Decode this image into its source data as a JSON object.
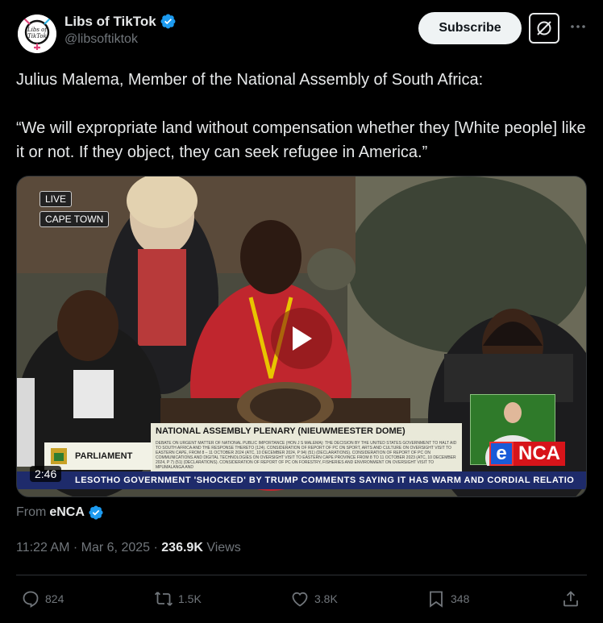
{
  "author": {
    "display_name": "Libs of TikTok",
    "handle": "@libsoftiktok",
    "avatar_text_line1": "Libs of",
    "avatar_text_line2": "TikTok",
    "verified": true
  },
  "header_actions": {
    "subscribe_label": "Subscribe",
    "grok_icon": "grok-icon",
    "more_icon": "more-icon"
  },
  "tweet": {
    "line1": "Julius Malema, Member of the National Assembly of South Africa:",
    "line2": "“We will expropriate land without compensation whether they [White people] like it or not. If they object, they can seek refugee in America.”"
  },
  "video": {
    "live_badge": "LIVE",
    "city_badge": "CAPE TOWN",
    "lower_third_title": "NATIONAL ASSEMBLY PLENARY (NIEUWMEESTER DOME)",
    "lower_third_body": "DEBATE ON URGENT MATTER OF NATIONAL PUBLIC IMPORTANCE (HON J S MALEMA): THE DECISION BY THE UNITED STATES GOVERNMENT TO HALT AID TO SOUTH AFRICA AND THE RESPONSE THERETO (124). CONSIDERATION OF REPORT OF PC ON SPORT, ARTS AND CULTURE ON OVERSIGHT VISIT TO EASTERN CAPE, FROM 8 – 11 OCTOBER 2024 (ATC, 10 DECEMBER 2024, P 94) (51) (DECLARATIONS). CONSIDERATION OF REPORT OF PC ON COMMUNICATIONS AND DIGITAL TECHNOLOGIES ON OVERSIGHT VISIT TO EASTERN CAPE PROVINCE FROM 8 TO 11 OCTOBER 2023 (ATC, 10 DECEMBER 2024, P 7) (51) (DECLARATIONS). CONSIDERATION OF REPORT OF PC ON FORESTRY, FISHERIES AND ENVIRONMENT ON OVERSIGHT VISIT TO MPUMALANGA AND",
    "parliament_label": "PARLIAMENT",
    "ticker": "LESOTHO GOVERNMENT 'SHOCKED' BY TRUMP COMMENTS SAYING IT HAS WARM AND CORDIAL RELATIO",
    "network_e": "e",
    "network_rest": "NCA",
    "duration": "2:46"
  },
  "source": {
    "from_label": "From",
    "name": "eNCA"
  },
  "meta": {
    "time": "11:22 AM",
    "date": "Mar 6, 2025",
    "views_count": "236.9K",
    "views_label": "Views"
  },
  "engagement": {
    "replies": "824",
    "reposts": "1.5K",
    "likes": "3.8K",
    "bookmarks": "348"
  },
  "colors": {
    "background": "#000000",
    "text": "#e7e9ea",
    "muted": "#71767b",
    "verified": "#1d9bf0",
    "divider": "#2f3336"
  }
}
